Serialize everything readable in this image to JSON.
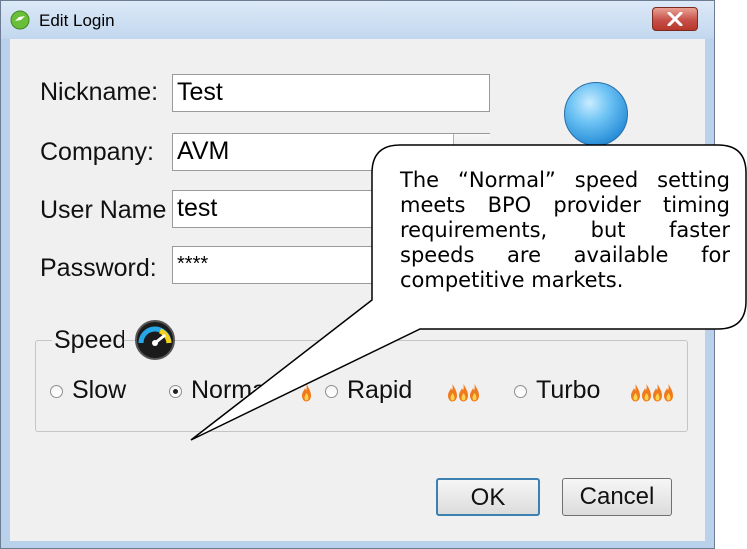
{
  "window": {
    "title": "Edit Login",
    "app_icon": "green-login-icon",
    "close_icon": "close-icon"
  },
  "form": {
    "nickname_label": "Nickname:",
    "nickname_value": "Test",
    "company_label": "Company:",
    "company_value": "AVM",
    "username_label": "User Name",
    "username_value": "test",
    "password_label": "Password:",
    "password_value": "****",
    "status_indicator_color": "#3a9be3"
  },
  "speed": {
    "group_label": "Speed",
    "group_icon": "speedometer-icon",
    "options": [
      {
        "label": "Slow",
        "selected": false,
        "flames": 0
      },
      {
        "label": "Normal",
        "selected": true,
        "flames": 1
      },
      {
        "label": "Rapid",
        "selected": false,
        "flames": 3
      },
      {
        "label": "Turbo",
        "selected": false,
        "flames": 4
      }
    ]
  },
  "buttons": {
    "ok_label": "OK",
    "cancel_label": "Cancel"
  },
  "callout": {
    "text": "The “Normal” speed setting meets BPO provider timing requirements, but faster speeds are available for competitive markets."
  },
  "colors": {
    "window_frame": "#b9d1ea",
    "client_bg": "#f0f0f0",
    "close_button": "#c75049",
    "flame": "#f07a1e"
  }
}
